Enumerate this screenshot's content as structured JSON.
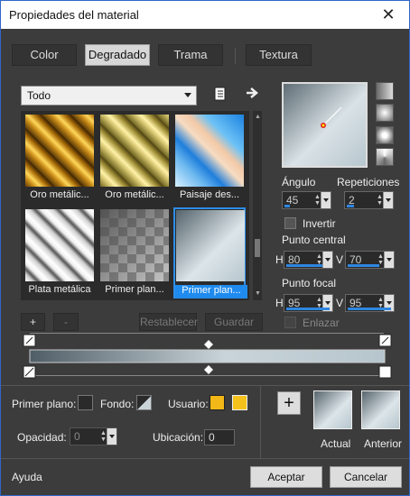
{
  "window": {
    "title": "Propiedades del material",
    "close": "✕"
  },
  "tabs": [
    {
      "label": "Color"
    },
    {
      "label": "Degradado"
    },
    {
      "label": "Trama"
    },
    {
      "label": "Textura"
    }
  ],
  "filter": {
    "value": "Todo"
  },
  "gradients": [
    {
      "label": "Oro metálic..."
    },
    {
      "label": "Oro metálic..."
    },
    {
      "label": "Paisaje des..."
    },
    {
      "label": "Plata metálica"
    },
    {
      "label": "Primer plan..."
    },
    {
      "label": "Primer plan..."
    }
  ],
  "library": {
    "add": "+",
    "remove": "-",
    "reset": "Restablecer",
    "save": "Guardar"
  },
  "angle": {
    "label": "Ángulo",
    "value": "45"
  },
  "repeats": {
    "label": "Repeticiones",
    "value": "2"
  },
  "invert": {
    "label": "Invertir"
  },
  "center": {
    "label": "Punto central",
    "h_label": "H",
    "h": "80",
    "v_label": "V",
    "v": "70"
  },
  "focal": {
    "label": "Punto focal",
    "h_label": "H",
    "h": "95",
    "v_label": "V",
    "v": "95"
  },
  "link": {
    "label": "Enlazar"
  },
  "bottom": {
    "fg_label": "Primer plano:",
    "bg_label": "Fondo:",
    "user_label": "Usuario:",
    "opacity_label": "Opacidad:",
    "opacity": "0",
    "location_label": "Ubicación:",
    "location": "0",
    "add": "+",
    "current": "Actual",
    "previous": "Anterior"
  },
  "footer": {
    "help": "Ayuda",
    "ok": "Aceptar",
    "cancel": "Cancelar"
  },
  "colors": {
    "accent": "#2d8ee8",
    "user1": "#f2b817",
    "user2": "#f5c21b"
  }
}
